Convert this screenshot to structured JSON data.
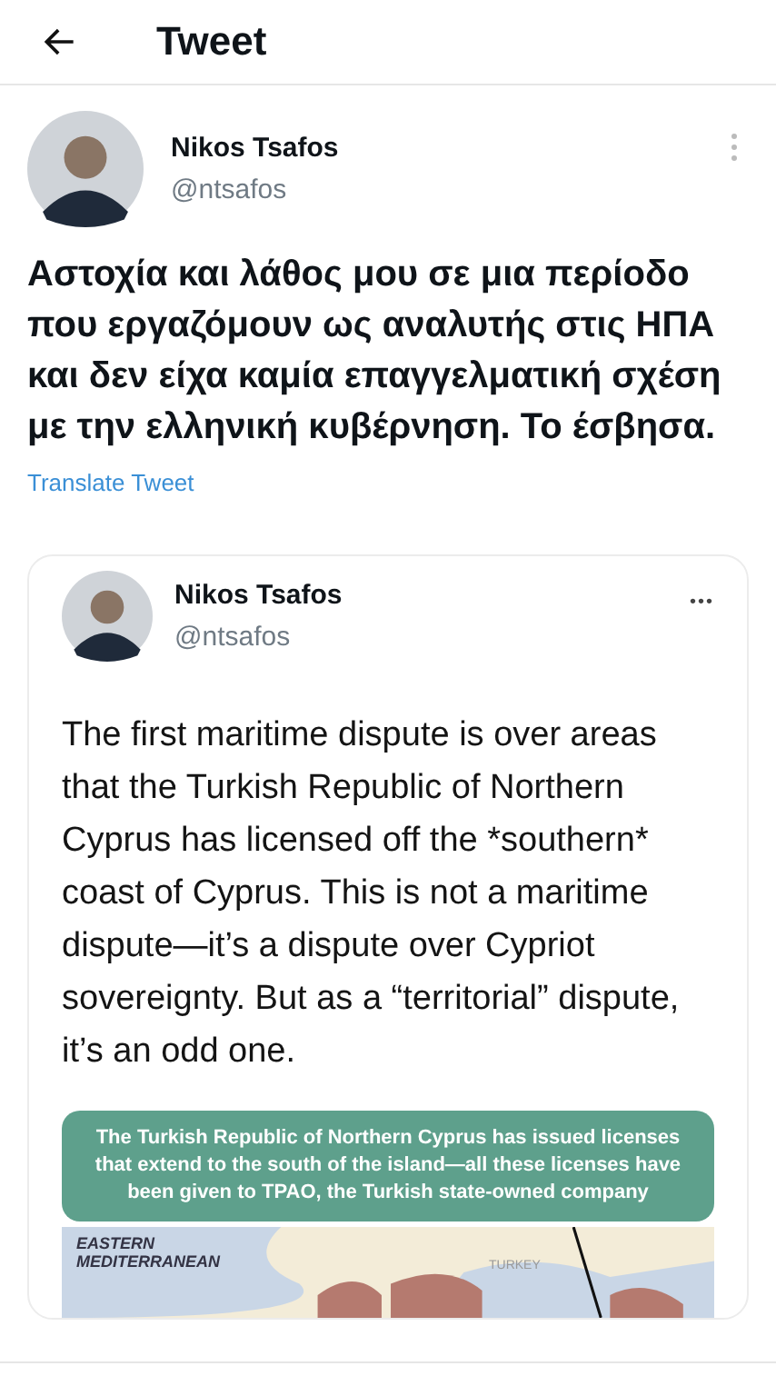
{
  "header": {
    "title": "Tweet"
  },
  "tweet": {
    "name": "Nikos Tsafos",
    "handle": "@ntsafos",
    "text": "Αστοχία και λάθος μου σε μια περίοδο που εργαζόμουν ως αναλυτής στις ΗΠΑ και δεν είχα καμία επαγγελματική σχέση με την ελληνική κυβέρνηση. Το έσβησα.",
    "translate": "Translate Tweet"
  },
  "quoted_tweet": {
    "name": "Nikos Tsafos",
    "handle": "@ntsafos",
    "more": "•••",
    "text": "The first maritime dispute is over areas that the Turkish Republic of Northern Cyprus has licensed off the *southern* coast of Cyprus. This is not a maritime dispute—it’s a dispute over Cypriot sovereignty. But as a “territorial” dispute, it’s an odd one.",
    "image": {
      "banner": "The Turkish Republic of Northern Cyprus has issued licenses that extend to the south of the island—all these licenses have been given to TPAO, the Turkish state-owned company",
      "map_title": "EASTERN MEDITERRANEAN",
      "map_label": "TURKEY"
    }
  }
}
